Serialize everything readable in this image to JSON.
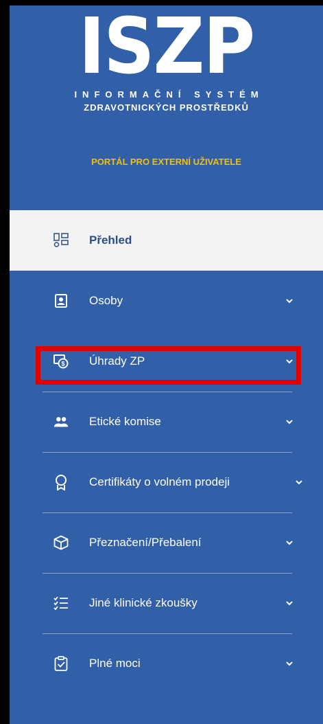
{
  "logo": {
    "title": "ISZP",
    "line1": "INFORMAČNÍ SYSTÉM",
    "line2": "ZDRAVOTNICKÝCH PROSTŘEDKŮ"
  },
  "portal_label": "PORTÁL PRO EXTERNÍ UŽIVATELE",
  "menu": {
    "items": [
      {
        "label": "Přehled",
        "icon": "dashboard-icon",
        "active": true
      },
      {
        "label": "Osoby",
        "icon": "person-card-icon"
      },
      {
        "label": "Úhrady ZP",
        "icon": "money-doc-icon"
      },
      {
        "label": "Etické komise",
        "icon": "people-icon"
      },
      {
        "label": "Certifikáty o volném prodeji",
        "icon": "award-icon"
      },
      {
        "label": "Přeznačení/Přebalení",
        "icon": "box-icon"
      },
      {
        "label": "Jiné klinické zkoušky",
        "icon": "checklist-icon"
      },
      {
        "label": "Plné moci",
        "icon": "clipboard-check-icon"
      }
    ]
  },
  "colors": {
    "sidebar_bg": "#3160a8",
    "active_bg": "#f3f3f3",
    "accent_yellow": "#f2c200",
    "highlight_red": "#e10000"
  }
}
